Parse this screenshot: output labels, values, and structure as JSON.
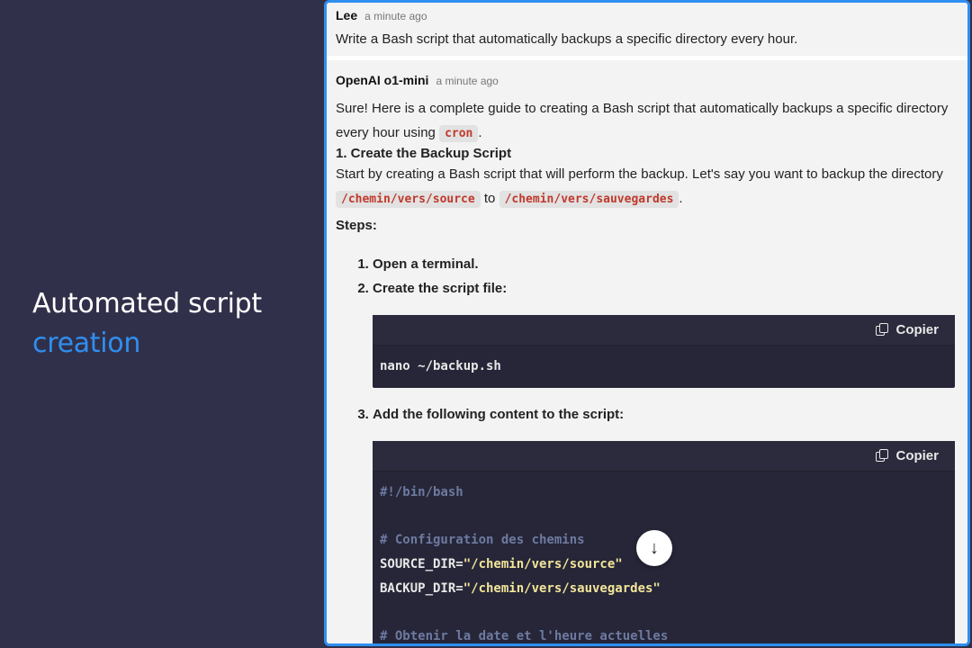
{
  "promo": {
    "line1": "Automated script",
    "line2": "creation"
  },
  "user_message": {
    "author": "Lee",
    "time": "a minute ago",
    "text": "Write a Bash script that automatically backups a specific directory every hour."
  },
  "bot_message": {
    "author": "OpenAI o1-mini",
    "time": "a minute ago",
    "intro_part1": "Sure! Here is a complete guide to creating a Bash script that automatically backups a specific directory every hour using ",
    "intro_code": "cron",
    "intro_end": ".",
    "heading": "1. Create the Backup Script",
    "para_part1": "Start by creating a Bash script that will perform the backup. Let's say you want to backup the directory ",
    "para_code1": "/chemin/vers/source",
    "para_to": " to ",
    "para_code2": "/chemin/vers/sauvegardes",
    "para_end": ".",
    "steps_label": "Steps:",
    "steps": [
      "Open a terminal.",
      "Create the script file:",
      "Add the following content to the script:"
    ],
    "copy_label": "Copier",
    "code1": "nano ~/backup.sh",
    "code2": {
      "shebang": "#!/bin/bash",
      "comment1": "# Configuration des chemins",
      "src_var": "SOURCE_DIR=",
      "src_val": "\"/chemin/vers/source\"",
      "bak_var": "BACKUP_DIR=",
      "bak_val": "\"/chemin/vers/sauvegardes\"",
      "comment2": "# Obtenir la date et l'heure actuelles"
    }
  },
  "scroll_icon": "arrow-down-icon",
  "colors": {
    "accent": "#2f8ff0",
    "background": "#31304a",
    "code_bg": "#262638"
  }
}
